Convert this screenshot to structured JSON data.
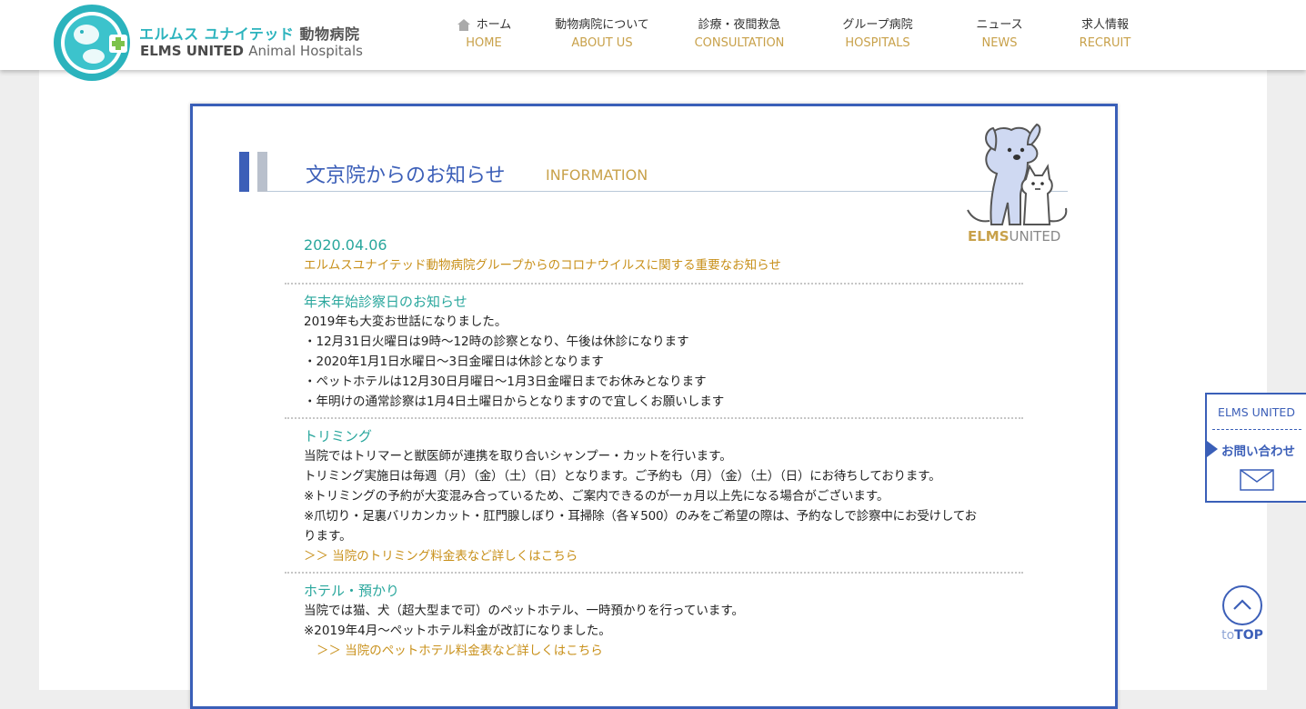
{
  "header": {
    "logo_jp_main": "エルムス ユナイテッド",
    "logo_jp_sub": "動物病院",
    "logo_en_bold": "ELMS UNITED",
    "logo_en_thin": "Animal Hospitals",
    "logo_ring_text": "ELMS United Animal Hospitals"
  },
  "nav": [
    {
      "jp": "ホーム",
      "en": "HOME",
      "icon": "home-icon"
    },
    {
      "jp": "動物病院について",
      "en": "ABOUT US"
    },
    {
      "jp": "診療・夜間救急",
      "en": "CONSULTATION"
    },
    {
      "jp": "グループ病院",
      "en": "HOSPITALS"
    },
    {
      "jp": "ニュース",
      "en": "NEWS"
    },
    {
      "jp": "求人情報",
      "en": "RECRUIT"
    }
  ],
  "section": {
    "title_jp": "文京院からのお知らせ",
    "title_en": "INFORMATION",
    "mascot_brand_a": "ELMS",
    "mascot_brand_b": "UNITED"
  },
  "news": [
    {
      "date": "2020.04.06",
      "link": "エルムスユナイテッド動物病院グループからのコロナウイルスに関する重要なお知らせ"
    },
    {
      "heading": "年末年始診察日のお知らせ",
      "lines": [
        "2019年も大変お世話になりました。",
        "・12月31日火曜日は9時〜12時の診察となり、午後は休診になります",
        "・2020年1月1日水曜日〜3日金曜日は休診となります",
        "・ペットホテルは12月30日月曜日〜1月3日金曜日までお休みとなります",
        "・年明けの通常診察は1月4日土曜日からとなりますので宜しくお願いします"
      ]
    },
    {
      "heading": "トリミング",
      "lines": [
        "当院ではトリマーと獣医師が連携を取り合いシャンプー・カットを行います。",
        "トリミング実施日は毎週（月）（金）（土）（日）となります。ご予約も（月）（金）（土）（日）にお待ちしております。",
        "※トリミングの予約が大変混み合っているため、ご案内できるのが一ヵ月以上先になる場合がございます。",
        "※爪切り・足裏バリカンカット・肛門腺しぼり・耳掃除（各￥500）のみをご希望の際は、予約なしで診察中にお受けしてお",
        "ります。"
      ],
      "link": "＞＞ 当院のトリミング料金表など詳しくはこちら"
    },
    {
      "heading": "ホテル・預かり",
      "lines": [
        "当院では猫、犬（超大型まで可）のペットホテル、一時預かりを行っています。",
        "※2019年4月〜ペットホテル料金が改訂になりました。"
      ],
      "link": "＞＞ 当院のペットホテル料金表など詳しくはこちら"
    }
  ],
  "contact": {
    "brand": "ELMS UNITED",
    "label": "お問い合わせ",
    "icon": "mail-icon"
  },
  "to_top": {
    "prefix": "to",
    "label": "TOP",
    "icon": "chevron-up-icon"
  },
  "colors": {
    "brand_blue": "#3c5fb8",
    "teal": "#2aa79d",
    "gold": "#c8a14a",
    "logo_cyan": "#2bb3bd"
  }
}
